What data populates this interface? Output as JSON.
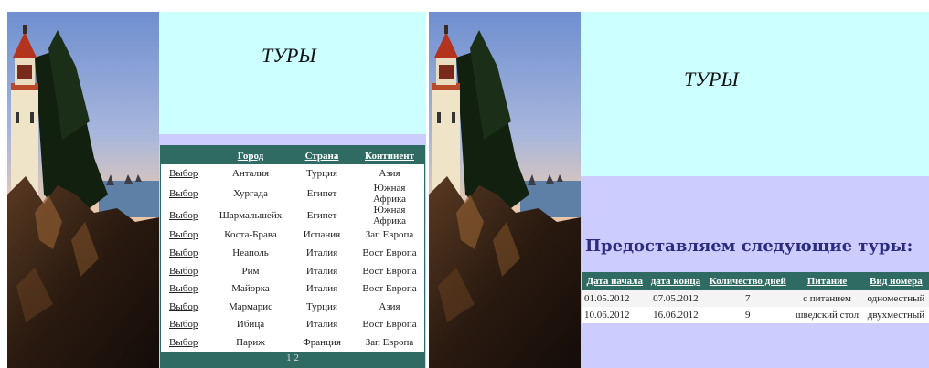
{
  "left_panel": {
    "banner_title": "ТУРЫ",
    "table": {
      "headers": [
        "",
        "Город",
        "Страна",
        "Континент"
      ],
      "rows": [
        [
          "Выбор",
          "Анталия",
          "Турция",
          "Азия"
        ],
        [
          "Выбор",
          "Хургада",
          "Египет",
          "Южная Африка"
        ],
        [
          "Выбор",
          "Шармальшейх",
          "Египет",
          "Южная Африка"
        ],
        [
          "Выбор",
          "Коста-Брава",
          "Испания",
          "Зап Европа"
        ],
        [
          "Выбор",
          "Неаполь",
          "Италия",
          "Вост Европа"
        ],
        [
          "Выбор",
          "Рим",
          "Италия",
          "Вост Европа"
        ],
        [
          "Выбор",
          "Майорка",
          "Италия",
          "Вост Европа"
        ],
        [
          "Выбор",
          "Мармарис",
          "Турция",
          "Азия"
        ],
        [
          "Выбор",
          "Ибица",
          "Италия",
          "Вост Европа"
        ],
        [
          "Выбор",
          "Париж",
          "Франция",
          "Зап Европа"
        ]
      ],
      "pager": "1 2"
    }
  },
  "right_panel": {
    "banner_title": "ТУРЫ",
    "heading": "Предоставляем следующие туры:",
    "table": {
      "headers": [
        "Дата начала",
        "дата конца",
        "Количество дней",
        "Питание",
        "Вид номера"
      ],
      "rows": [
        [
          "01.05.2012",
          "07.05.2012",
          "7",
          "с питанием",
          "одноместный"
        ],
        [
          "10.06.2012",
          "16.06.2012",
          "9",
          "шведский стол",
          "двухместный"
        ]
      ]
    }
  },
  "colors": {
    "banner_bg": "#ccffff",
    "content_bg": "#ccccff",
    "table_header_bg": "#2f6b62",
    "heading_color": "#2b2b80"
  },
  "images": {
    "photo_left": "lighthouse-photo",
    "photo_right": "lighthouse-photo"
  }
}
